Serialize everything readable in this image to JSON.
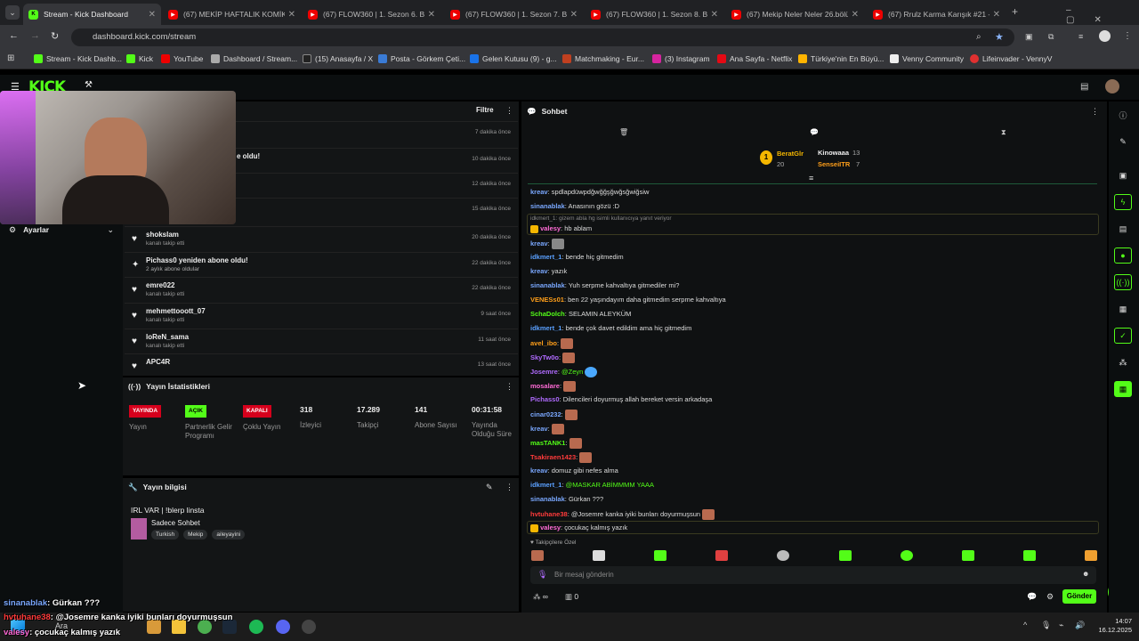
{
  "browser": {
    "tabs": [
      {
        "label": "Stream - Kick Dashboard",
        "fav": "kick-icon"
      },
      {
        "label": "(67) MEKİP HAFTALIK KOMİK A",
        "fav": "youtube-icon"
      },
      {
        "label": "(67) FLOW360 | 1. Sezon 6. Bö",
        "fav": "youtube-icon"
      },
      {
        "label": "(67) FLOW360 | 1. Sezon 7. Bö",
        "fav": "youtube-icon"
      },
      {
        "label": "(67) FLOW360 | 1. Sezon 8. Bö",
        "fav": "youtube-icon"
      },
      {
        "label": "(67) Mekip Neler Neler 26.bölü",
        "fav": "youtube-icon"
      },
      {
        "label": "(67) Rrulz Karma Karışık #21 -",
        "fav": "youtube-icon"
      }
    ],
    "url": "dashboard.kick.com/stream",
    "bookmarks": [
      "Stream - Kick Dashb...",
      "Kick",
      "YouTube",
      "Dashboard / Stream...",
      "(15) Anasayfa / X",
      "Posta - Görkem Çeti...",
      "Gelen Kutusu (9) - g...",
      "Matchmaking - Eur...",
      "(3) Instagram",
      "Ana Sayfa - Netflix",
      "Türkiye'nin En Büyü...",
      "Venny Community",
      "Lifeinvader - VennyV"
    ]
  },
  "left": {
    "settings_label": "Ayarlar"
  },
  "events": {
    "filter_label": "Filtre",
    "items": [
      {
        "name": "",
        "sub": "",
        "time": "7 dakika önce"
      },
      {
        "name": "e oldu!",
        "sub": "",
        "time": "10 dakika önce"
      },
      {
        "name": "",
        "sub": "",
        "time": "12 dakika önce"
      },
      {
        "name": "",
        "sub": "",
        "time": "15 dakika önce"
      },
      {
        "name": "shokslam",
        "sub": "kanalı takip etti",
        "time": "20 dakika önce"
      },
      {
        "name": "Pichass0 yeniden abone oldu!",
        "sub": "2 aylık abone oldular",
        "time": "22 dakika önce"
      },
      {
        "name": "emre022",
        "sub": "kanalı takip etti",
        "time": "22 dakika önce"
      },
      {
        "name": "mehmettooott_07",
        "sub": "kanalı takip etti",
        "time": "9 saat önce"
      },
      {
        "name": "loReN_sama",
        "sub": "kanalı takip etti",
        "time": "11 saat önce"
      },
      {
        "name": "APC4R",
        "sub": "kanalı takip etti",
        "time": "13 saat önce"
      }
    ]
  },
  "stats": {
    "title": "Yayın İstatistikleri",
    "badges": [
      {
        "badge": "YAYINDA",
        "label": "Yayın",
        "color": "#d6001c"
      },
      {
        "badge": "AÇIK",
        "label": "Partnerlik Gelir Programı",
        "color": "#53fc18"
      },
      {
        "badge": "KAPALI",
        "label": "Çoklu Yayın",
        "color": "#d6001c"
      }
    ],
    "values": [
      {
        "value": "318",
        "label": "İzleyici"
      },
      {
        "value": "17.289",
        "label": "Takipçi"
      },
      {
        "value": "141",
        "label": "Abone Sayısı"
      },
      {
        "value": "00:31:58",
        "label": "Yayında Olduğu Süre"
      }
    ]
  },
  "info": {
    "title": "Yayın bilgisi",
    "stream_title": "IRL VAR | !blerp linsta",
    "category": "Sadece Sohbet",
    "tags": [
      "Turkish",
      "Mekip",
      "aileyayini"
    ]
  },
  "chat": {
    "title": "Sohbet",
    "leaderboard": [
      {
        "name": "BeratGlr",
        "value": "20"
      },
      {
        "name": "Kinowaaa",
        "value": "13"
      },
      {
        "name": "SenseiITR",
        "value": "7"
      }
    ],
    "reply_note": "idkmert_1: gizem abla hg isimli kullanıcıya yanıt veriyor",
    "messages": [
      {
        "user": "kreav",
        "color": "#7aa8ff",
        "text": "spdlapdüwpdğwğğşğwğsğwiğsiw"
      },
      {
        "user": "sinanablak",
        "color": "#7aa8ff",
        "text": "Anasının gözü :D"
      },
      {
        "user": "valesy",
        "color": "#ff6bd6",
        "text": "hb ablam"
      },
      {
        "user": "kreav",
        "color": "#7aa8ff",
        "text": ""
      },
      {
        "user": "idkmert_1",
        "color": "#5aa0ff",
        "text": "bende hiç gitmedim"
      },
      {
        "user": "kreav",
        "color": "#7aa8ff",
        "text": "yazık"
      },
      {
        "user": "sinanablak",
        "color": "#7aa8ff",
        "text": "Yuh serpme kahvaltıya gitmediler mi?"
      },
      {
        "user": "VENESs01",
        "color": "#ff9f1a",
        "text": "ben 22 yaşındayım daha gitmedim serpme kahvaltıya"
      },
      {
        "user": "SchaDolch",
        "color": "#53fc18",
        "text": "SELAMIN ALEYKÜM"
      },
      {
        "user": "idkmert_1",
        "color": "#5aa0ff",
        "text": "bende çok davet edildim ama hiç gitmedim"
      },
      {
        "user": "avel_ibo",
        "color": "#ff9f1a",
        "text": ""
      },
      {
        "user": "SkyTw0o",
        "color": "#b06bff",
        "text": ""
      },
      {
        "user": "Josemre",
        "color": "#b06bff",
        "text": "@Zeyn"
      },
      {
        "user": "mosalare",
        "color": "#ff6bd6",
        "text": ""
      },
      {
        "user": "Pichass0",
        "color": "#b06bff",
        "text": "Dilencileri doyurmuş allah bereket versin arkadaşa"
      },
      {
        "user": "cinar0232",
        "color": "#7aa8ff",
        "text": ""
      },
      {
        "user": "kreav",
        "color": "#7aa8ff",
        "text": ""
      },
      {
        "user": "masTANK1",
        "color": "#53fc18",
        "text": ""
      },
      {
        "user": "Tsakiraen1423",
        "color": "#ff3b3b",
        "text": ""
      },
      {
        "user": "kreav",
        "color": "#7aa8ff",
        "text": "domuz gibi nefes alma"
      },
      {
        "user": "idkmert_1",
        "color": "#5aa0ff",
        "text": "@MASKAR ABİMMMM YAAA"
      },
      {
        "user": "sinanablak",
        "color": "#7aa8ff",
        "text": "Gürkan ???"
      },
      {
        "user": "hvtuhane38",
        "color": "#ff3b3b",
        "text": "@Josemre kanka iyiki bunları doyurmuşsun"
      },
      {
        "user": "valesy",
        "color": "#ff6bd6",
        "text": "çocukaç kalmış yazık"
      }
    ],
    "emote_bar_label": "Takipçilere Özel",
    "input_placeholder": "Bir mesaj gönderin",
    "send_label": "Gönder",
    "infinity": "∞",
    "count": "0"
  },
  "overlay": {
    "lines": [
      {
        "user": "sinanablak",
        "text": ": Gürkan ???"
      },
      {
        "user": "hvtuhane38",
        "text": ": @Josemre kanka iyiki bunları doyurmuşsun"
      },
      {
        "user": "valesy",
        "text": ": çocukaç kalmış yazık"
      }
    ]
  },
  "taskbar": {
    "search_label": "Ara",
    "time": "14:07",
    "date": "16.12.2025"
  }
}
